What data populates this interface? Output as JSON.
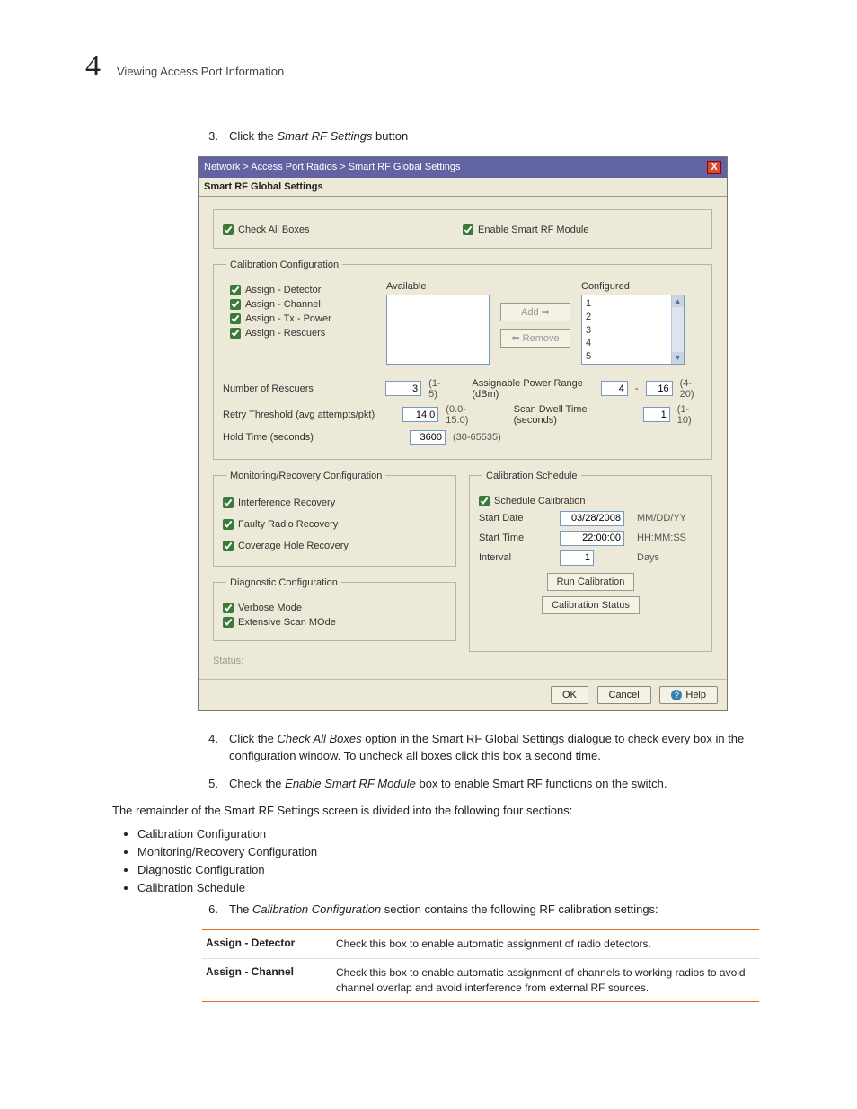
{
  "header": {
    "chapnum": "4",
    "chaptitle": "Viewing Access Port Information"
  },
  "steps": {
    "s3": {
      "num": "3.",
      "pre": "Click the ",
      "em": "Smart RF Settings",
      "post": " button"
    },
    "s4": {
      "num": "4.",
      "pre": "Click the ",
      "em": "Check All Boxes",
      "post": " option in the Smart RF Global Settings dialogue to check every box in the configuration window. To uncheck all boxes click this box a second time."
    },
    "s5": {
      "num": "5.",
      "pre": "Check the ",
      "em": "Enable Smart RF Module",
      "post": " box to enable Smart RF functions on the switch."
    },
    "s5b": "The remainder of the Smart RF Settings screen is divided into the following four sections:",
    "bullets": [
      "Calibration Configuration",
      "Monitoring/Recovery Configuration",
      "Diagnostic Configuration",
      "Calibration Schedule"
    ],
    "s6": {
      "num": "6.",
      "pre": "The ",
      "em": "Calibration Configuration",
      "post": " section contains the following RF calibration settings:"
    }
  },
  "dialog": {
    "breadcrumb": "Network  >  Access Port Radios  >  Smart RF Global Settings",
    "subtitle": "Smart RF Global Settings",
    "close": "X",
    "checkAll": "Check All Boxes",
    "enableModule": "Enable Smart RF Module",
    "calib": {
      "legend": "Calibration Configuration",
      "assignDetector": "Assign - Detector",
      "assignChannel": "Assign - Channel",
      "assignTxPower": "Assign - Tx - Power",
      "assignRescuers": "Assign - Rescuers",
      "availableLabel": "Available",
      "configuredLabel": "Configured",
      "configured": [
        "1",
        "2",
        "3",
        "4",
        "5"
      ],
      "addBtn": "Add  ➡",
      "removeBtn": "⬅ Remove",
      "numRescuersLabel": "Number of Rescuers",
      "numRescuers": "3",
      "numRescuersHint": "(1-5)",
      "aprLabel": "Assignable Power Range (dBm)",
      "aprMin": "4",
      "aprDash": "-",
      "aprMax": "16",
      "aprHint": "(4-20)",
      "retryLabel": "Retry Threshold  (avg attempts/pkt)",
      "retryVal": "14.0",
      "retryHint": "(0.0-15.0)",
      "dwellLabel": "Scan Dwell Time (seconds)",
      "dwellVal": "1",
      "dwellHint": "(1-10)",
      "holdLabel": "Hold Time (seconds)",
      "holdVal": "3600",
      "holdHint": "(30-65535)"
    },
    "mon": {
      "legend": "Monitoring/Recovery Configuration",
      "interference": "Interference Recovery",
      "faulty": "Faulty Radio Recovery",
      "coverage": "Coverage Hole Recovery"
    },
    "sched": {
      "legend": "Calibration Schedule",
      "scheduleCalib": "Schedule Calibration",
      "startDateL": "Start Date",
      "startDateV": "03/28/2008",
      "startDateH": "MM/DD/YY",
      "startTimeL": "Start Time",
      "startTimeV": "22:00:00",
      "startTimeH": "HH:MM:SS",
      "intervalL": "Interval",
      "intervalV": "1",
      "intervalH": "Days",
      "runBtn": "Run Calibration",
      "statusBtn": "Calibration Status"
    },
    "diag": {
      "legend": "Diagnostic Configuration",
      "verbose": "Verbose Mode",
      "extensive": "Extensive Scan MOde"
    },
    "status": "Status:",
    "ok": "OK",
    "cancel": "Cancel",
    "help": "Help"
  },
  "deftable": {
    "r1k": "Assign - Detector",
    "r1v": "Check this box to enable automatic assignment of radio detectors.",
    "r2k": "Assign - Channel",
    "r2v": "Check this box to enable automatic assignment of channels to working radios to avoid channel overlap and avoid interference from external RF sources."
  }
}
